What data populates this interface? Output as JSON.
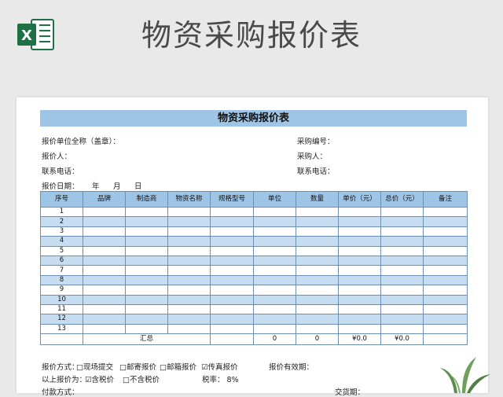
{
  "header": {
    "title": "物资采购报价表",
    "app_icon": "excel-icon"
  },
  "form": {
    "title": "物资采购报价表",
    "info": {
      "quoter_company": "报价单位全称（盖章）：",
      "purchase_no": "采购编号：",
      "quoter_person": "报价人：",
      "purchaser": "采购人：",
      "phone_left": "联系电话：",
      "phone_right": "联系电话：",
      "quote_date_label": "报价日期：",
      "year": "年",
      "month": "月",
      "day": "日"
    },
    "table": {
      "columns": [
        "序号",
        "品牌",
        "制造商",
        "物资名称",
        "规格型号",
        "单位",
        "数量",
        "单价（元）",
        "总价（元）",
        "备注"
      ],
      "rows": [
        "1",
        "2",
        "3",
        "4",
        "5",
        "6",
        "7",
        "8",
        "9",
        "10",
        "11",
        "12",
        "13"
      ],
      "summary": {
        "label": "汇总",
        "unit_total": "0",
        "qty_total": "0",
        "unit_price_total": "¥0.0",
        "total_price": "¥0.0"
      }
    },
    "footer": {
      "quote_method_label": "报价方式：",
      "opt1": "□现场提交",
      "opt2": "□邮寄报价",
      "opt3": "□邮箱报价",
      "opt4": "☑传真报价",
      "validity": "报价有效期：",
      "tax_label": "以上报价为：",
      "tax_opt1": "☑含税价",
      "tax_opt2": "□不含税价",
      "tax_rate": "税率：  8%",
      "payment": "付款方式：",
      "delivery": "交货期："
    }
  },
  "colors": {
    "header_fill": "#9ec5e6",
    "stripe_fill": "#c6ddf1",
    "excel_green": "#1e7145"
  }
}
